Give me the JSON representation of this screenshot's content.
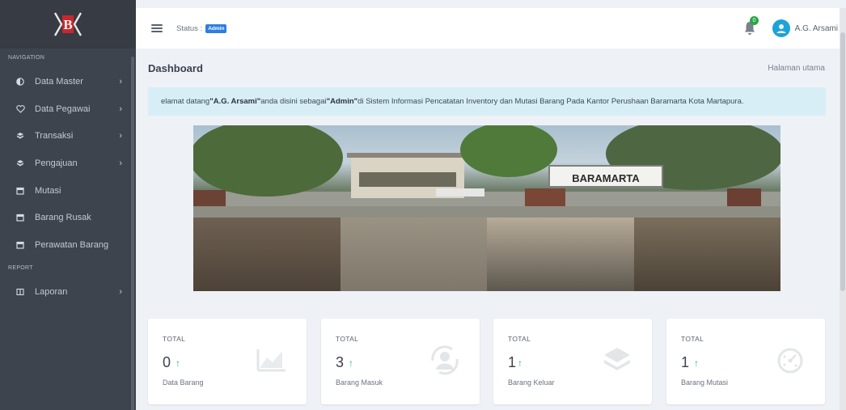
{
  "app": {
    "logo_alt": "B"
  },
  "sidebar": {
    "section_navigation": "NAVIGATION",
    "section_report": "REPORT",
    "items": [
      {
        "label": "Data Master",
        "icon": "half-circle-icon",
        "has_submenu": true
      },
      {
        "label": "Data Pegawai",
        "icon": "heart-icon",
        "has_submenu": true
      },
      {
        "label": "Transaksi",
        "icon": "cube-icon",
        "has_submenu": true
      },
      {
        "label": "Pengajuan",
        "icon": "cube-icon",
        "has_submenu": true
      },
      {
        "label": "Mutasi",
        "icon": "calendar-icon",
        "has_submenu": false
      },
      {
        "label": "Barang Rusak",
        "icon": "calendar-icon",
        "has_submenu": false
      },
      {
        "label": "Perawatan Barang",
        "icon": "calendar-icon",
        "has_submenu": false
      }
    ],
    "report_items": [
      {
        "label": "Laporan",
        "icon": "columns-icon",
        "has_submenu": true
      }
    ]
  },
  "topbar": {
    "status_label": "Status :",
    "status_badge": "Admin",
    "notification_count": "0",
    "user_name": "A.G. Arsami"
  },
  "page": {
    "title": "Dashboard",
    "breadcrumb": "Halaman utama",
    "welcome": {
      "prefix": "elamat datang ",
      "name": "\"A.G. Arsami\"",
      "middle": " anda disini sebagai ",
      "role": "\"Admin\"",
      "suffix": "di Sistem Informasi Pencatatan Inventory dan Mutasi Barang Pada Kantor Perushaan Baramarta Kota Martapura."
    },
    "photo_sign": "BARAMARTA"
  },
  "cards": [
    {
      "label": "TOTAL",
      "value": "0",
      "arrow": "↑",
      "desc": "Data Barang",
      "icon": "chart-area-icon"
    },
    {
      "label": "TOTAL",
      "value": "3",
      "arrow": "↑",
      "desc": "Barang Masuk",
      "icon": "user-refresh-icon"
    },
    {
      "label": "TOTAL",
      "value": "1",
      "arrow": "↑",
      "desc": "Barang Keluar",
      "icon": "layers-icon"
    },
    {
      "label": "TOTAL",
      "value": "1",
      "arrow": "↑",
      "desc": "Barang Mutasi",
      "icon": "timer-icon"
    }
  ],
  "colors": {
    "sidebar_bg": "#3e444e",
    "accent": "#2f7de1",
    "alert_bg": "#d7eef6",
    "up_arrow": "#2fb36d"
  }
}
